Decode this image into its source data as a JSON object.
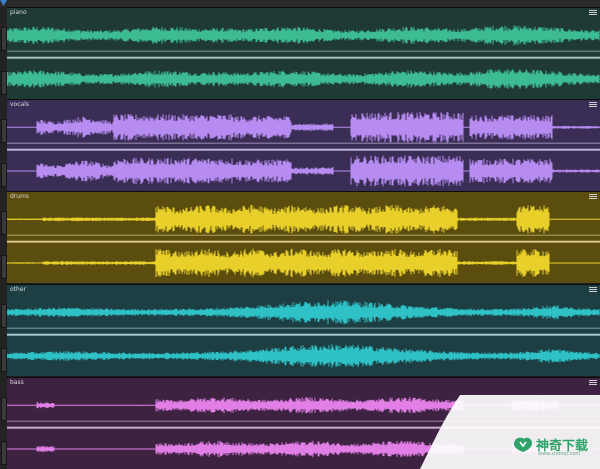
{
  "ruler": {
    "marker": "playhead-marker"
  },
  "tracks": [
    {
      "name": "piano",
      "color": "#3dbb93",
      "bg": "#1f3a35",
      "lane": "#b8ded4",
      "profile": "piano"
    },
    {
      "name": "vocals",
      "color": "#b78cf0",
      "bg": "#3a2e57",
      "lane": "#d9cdef",
      "profile": "vocals"
    },
    {
      "name": "drums",
      "color": "#e8cf2a",
      "bg": "#5b4d0d",
      "lane": "#eedd99",
      "profile": "drums"
    },
    {
      "name": "other",
      "color": "#2ec1c6",
      "bg": "#1d3f44",
      "lane": "#bde3e5",
      "profile": "other"
    },
    {
      "name": "bass",
      "color": "#e27fe6",
      "bg": "#3d2241",
      "lane": "#e3c7e6",
      "profile": "bass"
    }
  ],
  "watermark": {
    "text": "神奇下载",
    "url": "www.shenqi.com"
  }
}
